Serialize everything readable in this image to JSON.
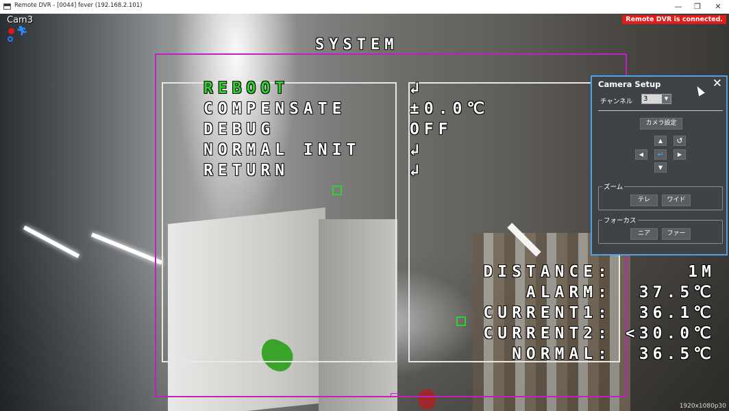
{
  "window": {
    "title": "Remote DVR - [0044] fever (192.168.2.101)",
    "minimize_glyph": "—",
    "restore_glyph": "❐",
    "close_glyph": "✕"
  },
  "video": {
    "camera_label": "Cam3",
    "status_banner": "Remote DVR is connected.",
    "resolution": "1920x1080p30",
    "status_icons": [
      "record-icon",
      "motion-runner-icon",
      "zoom-icon"
    ]
  },
  "osd": {
    "heading": "SYSTEM",
    "menu": [
      {
        "label": "REBOOT",
        "value": "↲",
        "selected": true
      },
      {
        "label": "COMPENSATE",
        "value": "±0.0℃",
        "selected": false
      },
      {
        "label": "DEBUG",
        "value": "OFF",
        "selected": false
      },
      {
        "label": "NORMAL INIT",
        "value": "↲",
        "selected": false
      },
      {
        "label": "RETURN",
        "value": "↲",
        "selected": false
      }
    ],
    "readings": [
      {
        "label": "DISTANCE:",
        "value": "1M"
      },
      {
        "label": "ALARM:",
        "value": "37.5℃"
      },
      {
        "label": "CURRENT1:",
        "value": "36.1℃"
      },
      {
        "label": "CURRENT2:",
        "value": "<30.0℃"
      },
      {
        "label": "NORMAL:",
        "value": "36.5℃"
      }
    ],
    "colors": {
      "selected": "#2ed12e",
      "normal": "#ffffff",
      "frame": "#c020c0"
    }
  },
  "camera_setup": {
    "title": "Camera Setup",
    "close_glyph": "✕",
    "channel_label": "チャンネル",
    "channel_value": "3",
    "camera_settings_button": "カメラ設定",
    "ptz": {
      "up": "▲",
      "rotate": "↺",
      "left": "◀",
      "ok": "↵",
      "right": "▶",
      "down": "▼"
    },
    "zoom": {
      "label": "ズーム",
      "tele": "テレ",
      "wide": "ワイド"
    },
    "focus": {
      "label": "フォーカス",
      "near": "ニア",
      "far": "ファー"
    },
    "accent": "#4ea4e8"
  }
}
